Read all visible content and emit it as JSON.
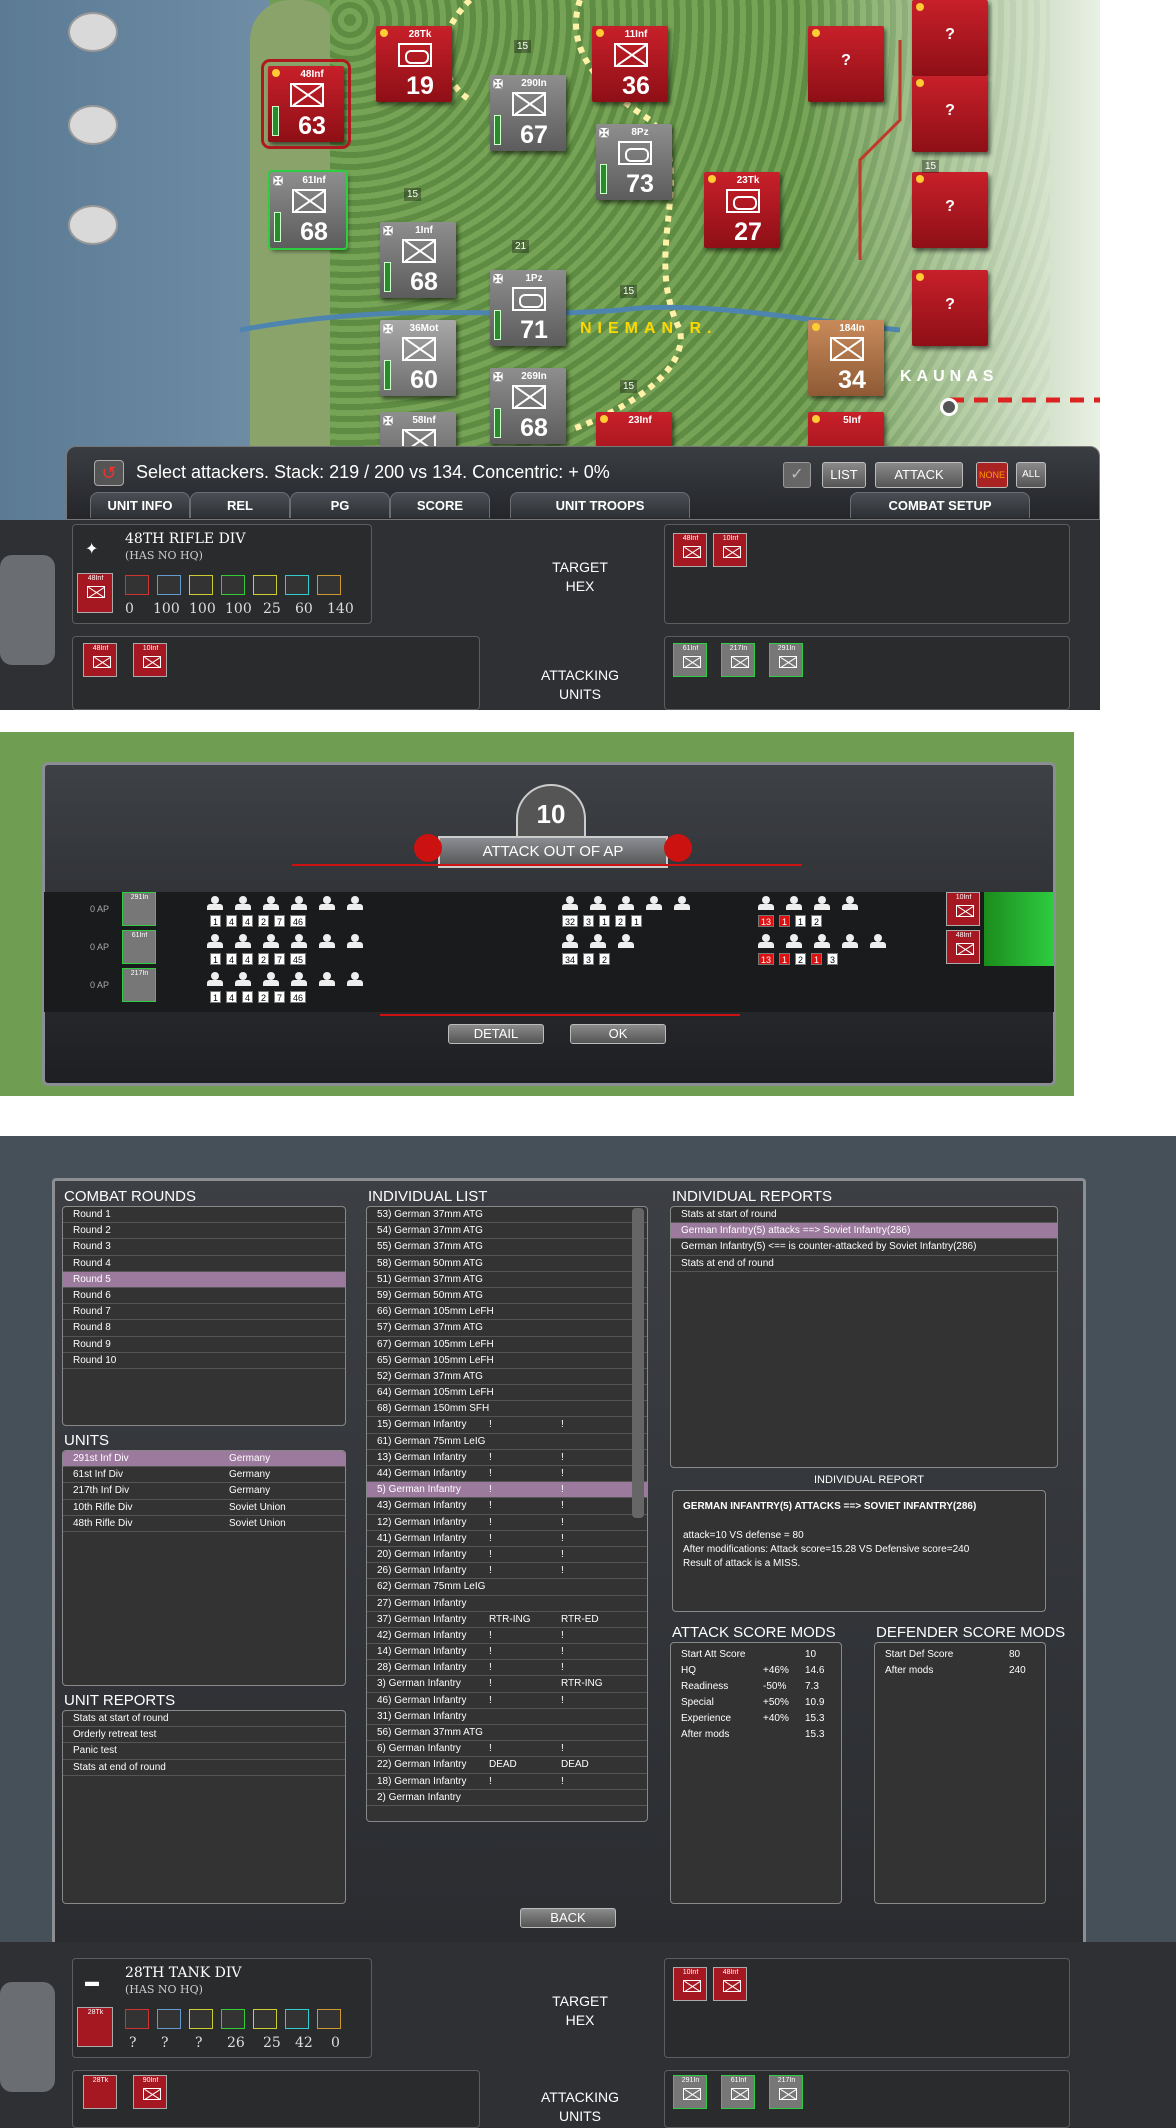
{
  "map": {
    "units_top": [
      {
        "name": "48Inf",
        "str": "63",
        "side": "sov",
        "kind": "inf"
      },
      {
        "name": "28Tk",
        "str": "19",
        "side": "sov",
        "kind": "tk"
      },
      {
        "name": "11Inf",
        "str": "36",
        "side": "sov",
        "kind": "inf"
      },
      {
        "name": "290In",
        "str": "67",
        "side": "ger",
        "kind": "inf"
      },
      {
        "name": "8Pz",
        "str": "73",
        "side": "ger",
        "kind": "tk"
      },
      {
        "name": "61Inf",
        "str": "68",
        "side": "ger",
        "kind": "inf"
      },
      {
        "name": "1Inf",
        "str": "68",
        "side": "ger",
        "kind": "inf"
      },
      {
        "name": "23Tk",
        "str": "27",
        "side": "sov",
        "kind": "tk"
      },
      {
        "name": "1Pz",
        "str": "71",
        "side": "ger",
        "kind": "tk"
      },
      {
        "name": "36Mot",
        "str": "60",
        "side": "ger",
        "kind": "inf"
      },
      {
        "name": "184In",
        "str": "34",
        "side": "tan",
        "kind": "inf"
      },
      {
        "name": "269In",
        "str": "68",
        "side": "ger",
        "kind": "inf"
      },
      {
        "name": "58Inf",
        "str": "",
        "side": "ger",
        "kind": "inf"
      },
      {
        "name": "23Inf",
        "str": "",
        "side": "sov",
        "kind": "inf"
      },
      {
        "name": "5Inf",
        "str": "",
        "side": "sov",
        "kind": "inf"
      }
    ],
    "unknown_mark": "?",
    "river_label": "NIEMAN R.",
    "city_label": "KAUNAS",
    "hex_numbers": [
      "15",
      "15",
      "21",
      "15",
      "15",
      "15"
    ]
  },
  "command_bar": {
    "status": "Select attackers. Stack:  219 / 200 vs 134. Concentric: + 0%",
    "list_button": "LIST",
    "attack_button": "ATTACK",
    "none_button": "NONE",
    "all_button": "ALL",
    "tabs": [
      "UNIT INFO",
      "REL",
      "PG",
      "SCORE",
      "UNIT TROOPS",
      "COMBAT SETUP"
    ]
  },
  "panel_top": {
    "unit_name": "48TH RIFLE DIV",
    "hq_note": "(HAS NO HQ)",
    "mini_label": "48Inf",
    "stats": [
      "0",
      "100",
      "100",
      "100",
      "25",
      "60",
      "140"
    ],
    "target_hex": "TARGET\nHEX",
    "attacking_units": "ATTACKING\nUNITS",
    "target_units": [
      "48Inf",
      "10Inf"
    ],
    "left_units": [
      "48Inf",
      "10Inf"
    ],
    "attackers": [
      "61Inf",
      "217In",
      "291In"
    ]
  },
  "battle": {
    "number": "10",
    "title": "ATTACK OUT OF AP",
    "ap_labels": [
      "0 AP",
      "0 AP",
      "0 AP"
    ],
    "attacker_tags": [
      "291In",
      "61Inf",
      "217In"
    ],
    "attacker_counts": [
      [
        "1",
        "4",
        "4",
        "2",
        "7",
        "46"
      ],
      [
        "1",
        "4",
        "4",
        "2",
        "7",
        "45"
      ],
      [
        "1",
        "4",
        "4",
        "2",
        "7",
        "46"
      ]
    ],
    "defender_counts": [
      [
        "32",
        "3",
        "1",
        "2",
        "1"
      ],
      [
        "34",
        "3",
        "2"
      ]
    ],
    "right_counts": [
      [
        "13",
        "1",
        "1",
        "2"
      ],
      [
        "13",
        "1",
        "2",
        "1",
        "3"
      ]
    ],
    "defender_tags": [
      "10Inf",
      "48Inf"
    ],
    "detail_button": "DETAIL",
    "ok_button": "OK"
  },
  "report": {
    "combat_rounds_title": "COMBAT ROUNDS",
    "rounds": [
      "Round 1",
      "Round 2",
      "Round 3",
      "Round 4",
      "Round 5",
      "Round 6",
      "Round 7",
      "Round 8",
      "Round 9",
      "Round 10"
    ],
    "units_title": "UNITS",
    "units": [
      {
        "name": "291st Inf Div",
        "nation": "Germany"
      },
      {
        "name": "61st Inf Div",
        "nation": "Germany"
      },
      {
        "name": "217th Inf Div",
        "nation": "Germany"
      },
      {
        "name": "10th Rifle Div",
        "nation": "Soviet Union"
      },
      {
        "name": "48th Rifle Div",
        "nation": "Soviet Union"
      }
    ],
    "unit_reports_title": "UNIT REPORTS",
    "unit_reports": [
      "Stats at start of round",
      "Orderly retreat test",
      "Panic test",
      "Stats at end of round"
    ],
    "individual_list_title": "INDIVIDUAL LIST",
    "individual_list": [
      [
        "53) German 37mm ATG",
        "",
        ""
      ],
      [
        "54) German 37mm ATG",
        "",
        ""
      ],
      [
        "55) German 37mm ATG",
        "",
        ""
      ],
      [
        "58) German 50mm ATG",
        "",
        ""
      ],
      [
        "51) German 37mm ATG",
        "",
        ""
      ],
      [
        "59) German 50mm ATG",
        "",
        ""
      ],
      [
        "66) German 105mm LeFH",
        "",
        ""
      ],
      [
        "57) German 37mm ATG",
        "",
        ""
      ],
      [
        "67) German 105mm LeFH",
        "",
        ""
      ],
      [
        "65) German 105mm LeFH",
        "",
        ""
      ],
      [
        "52) German 37mm ATG",
        "",
        ""
      ],
      [
        "64) German 105mm LeFH",
        "",
        ""
      ],
      [
        "68) German 150mm SFH",
        "",
        ""
      ],
      [
        "15) German Infantry",
        "!",
        "!"
      ],
      [
        "61) German 75mm LeIG",
        "",
        ""
      ],
      [
        "13) German Infantry",
        "!",
        "!"
      ],
      [
        "44) German Infantry",
        "!",
        "!"
      ],
      [
        "5) German Infantry",
        "!",
        "!"
      ],
      [
        "43) German Infantry",
        "!",
        "!"
      ],
      [
        "12) German Infantry",
        "!",
        "!"
      ],
      [
        "41) German Infantry",
        "!",
        "!"
      ],
      [
        "20) German Infantry",
        "!",
        "!"
      ],
      [
        "26) German Infantry",
        "!",
        "!"
      ],
      [
        "62) German 75mm LeIG",
        "",
        ""
      ],
      [
        "27) German Infantry",
        "",
        ""
      ],
      [
        "37) German Infantry",
        "RTR-ING",
        "RTR-ED"
      ],
      [
        "42) German Infantry",
        "!",
        "!"
      ],
      [
        "14) German Infantry",
        "!",
        "!"
      ],
      [
        "28) German Infantry",
        "!",
        "!"
      ],
      [
        "3) German Infantry",
        "!",
        "RTR-ING"
      ],
      [
        "46) German Infantry",
        "!",
        "!"
      ],
      [
        "31) German Infantry",
        "",
        ""
      ],
      [
        "56) German 37mm ATG",
        "",
        ""
      ],
      [
        "6) German Infantry",
        "!",
        "!"
      ],
      [
        "22) German Infantry",
        "DEAD",
        "DEAD"
      ],
      [
        "18) German Infantry",
        "!",
        "!"
      ],
      [
        "2) German Infantry",
        "",
        ""
      ]
    ],
    "individual_reports_title": "INDIVIDUAL REPORTS",
    "individual_reports": [
      "Stats at start of round",
      "German Infantry(5) attacks ==> Soviet Infantry(286)",
      "German Infantry(5) <== is counter-attacked by Soviet Infantry(286)",
      "Stats at end of round"
    ],
    "individual_report_title": "INDIVIDUAL REPORT",
    "ir_head": "GERMAN INFANTRY(5) ATTACKS ==> SOVIET INFANTRY(286)",
    "ir_line1": "attack=10 VS defense = 80",
    "ir_line2": "After modifications: Attack score=15.28 VS Defensive score=240",
    "ir_line3": "Result of attack is a MISS.",
    "attack_mods_title": "ATTACK SCORE MODS",
    "attack_mods": [
      [
        "Start Att Score",
        "",
        "10"
      ],
      [
        "HQ",
        "+46%",
        "14.6"
      ],
      [
        "Readiness",
        "-50%",
        "7.3"
      ],
      [
        "Special",
        "+50%",
        "10.9"
      ],
      [
        "Experience",
        "+40%",
        "15.3"
      ],
      [
        "After mods",
        "",
        "15.3"
      ]
    ],
    "defender_mods_title": "DEFENDER SCORE MODS",
    "defender_mods": [
      [
        "Start Def Score",
        "80"
      ],
      [
        "After mods",
        "240"
      ]
    ],
    "back_button": "BACK"
  },
  "panel_bottom": {
    "unit_name": "28TH TANK DIV",
    "hq_note": "(HAS NO HQ)",
    "mini_label": "28Tk",
    "stats": [
      "?",
      "?",
      "?",
      "26",
      "25",
      "42",
      "0"
    ],
    "target_hex": "TARGET\nHEX",
    "attacking_units": "ATTACKING\nUNITS",
    "target_units": [
      "10Inf",
      "48Inf"
    ],
    "left_units": [
      "28Tk",
      "90Inf"
    ],
    "attackers": [
      "291In",
      "61Inf",
      "217In"
    ]
  },
  "colors": {
    "soviet": "#a51821",
    "german": "#777777",
    "select": "#9b7a9e",
    "accent_river": "#ffd700"
  }
}
